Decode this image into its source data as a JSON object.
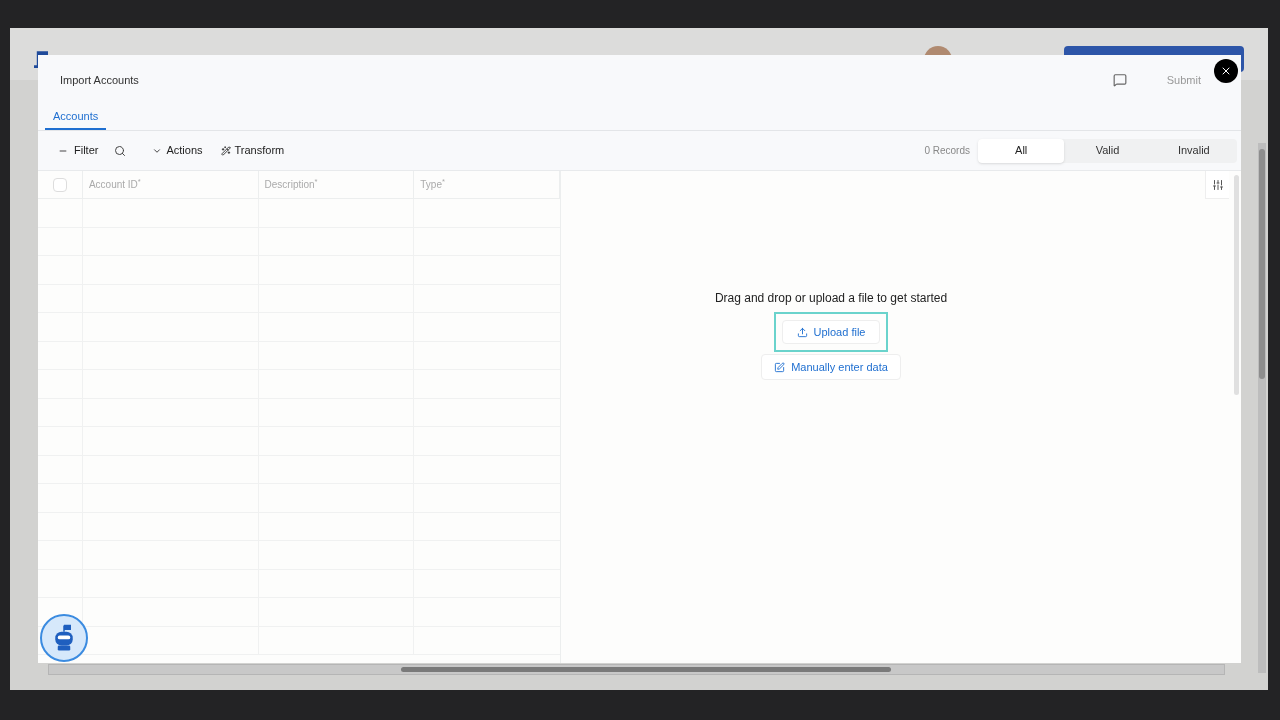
{
  "modal": {
    "title": "Import Accounts",
    "submit": {
      "label": "Submit",
      "disabled": true
    },
    "tabs": [
      {
        "label": "Accounts",
        "selected": true
      }
    ],
    "toolbar": {
      "filter": "Filter",
      "actions": "Actions",
      "transform": "Transform",
      "records": "0 Records",
      "segments": [
        {
          "label": "All",
          "selected": true
        },
        {
          "label": "Valid",
          "selected": false
        },
        {
          "label": "Invalid",
          "selected": false
        }
      ]
    },
    "table": {
      "select_all_checked": false,
      "columns": [
        "Account ID$^{*}$",
        "Description$^{*}$",
        "Type$^{*}$"
      ]
    },
    "empty_state": {
      "message": "Drag and drop or upload a file to get started",
      "upload": {
        "label": "Upload file",
        "focused": true
      },
      "manual": "Manually enter data"
    }
  }
}
